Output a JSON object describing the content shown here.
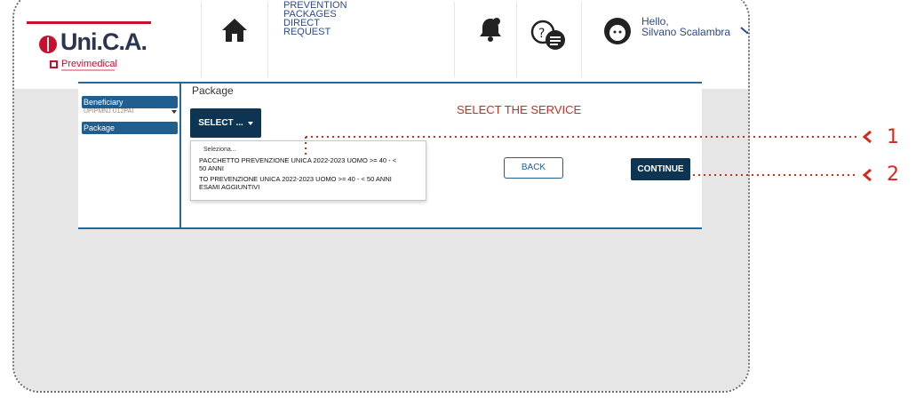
{
  "header": {
    "logo": {
      "brand": "Uni.C.A.",
      "subbrand": "Previmedical"
    },
    "nav": {
      "line1": "PREVENTION",
      "line2": "PACKAGES",
      "line3": "DIRECT",
      "line4": "REQUEST"
    },
    "user": {
      "greeting": "Hello,",
      "name": "Silvano Scalambra"
    },
    "icons": [
      "home-icon",
      "bell-icon",
      "chat-icon",
      "avatar-icon",
      "chevron-icon"
    ]
  },
  "sidebar": {
    "items": [
      {
        "label": "Beneficiary"
      },
      {
        "label": "Package"
      }
    ],
    "sub_value": "UPIPMNJ U12PAI"
  },
  "package": {
    "label": "Package",
    "select_label": "SELECT ...",
    "dropdown": {
      "placeholder": "Seleziona...",
      "options": [
        {
          "line1": "PACCHETTO PREVENZIONE UNICA 2022-2023 UOMO >= 40 - <",
          "line2": "50 ANNI"
        },
        {
          "line1": "TO PREVENZIONE UNICA 2022-2023 UOMO >= 40 - < 50 ANNI",
          "line2": "ESAMI AGGIUNTIVI"
        }
      ]
    }
  },
  "annotation": {
    "select_service": "SELECT THE SERVICE",
    "num1": "1",
    "num2": "2"
  },
  "actions": {
    "back": "BACK",
    "continue": "CONTINUE"
  },
  "colors": {
    "accent_red": "#d42a1e",
    "navy": "#0e3454",
    "blue": "#1f5e8e"
  }
}
